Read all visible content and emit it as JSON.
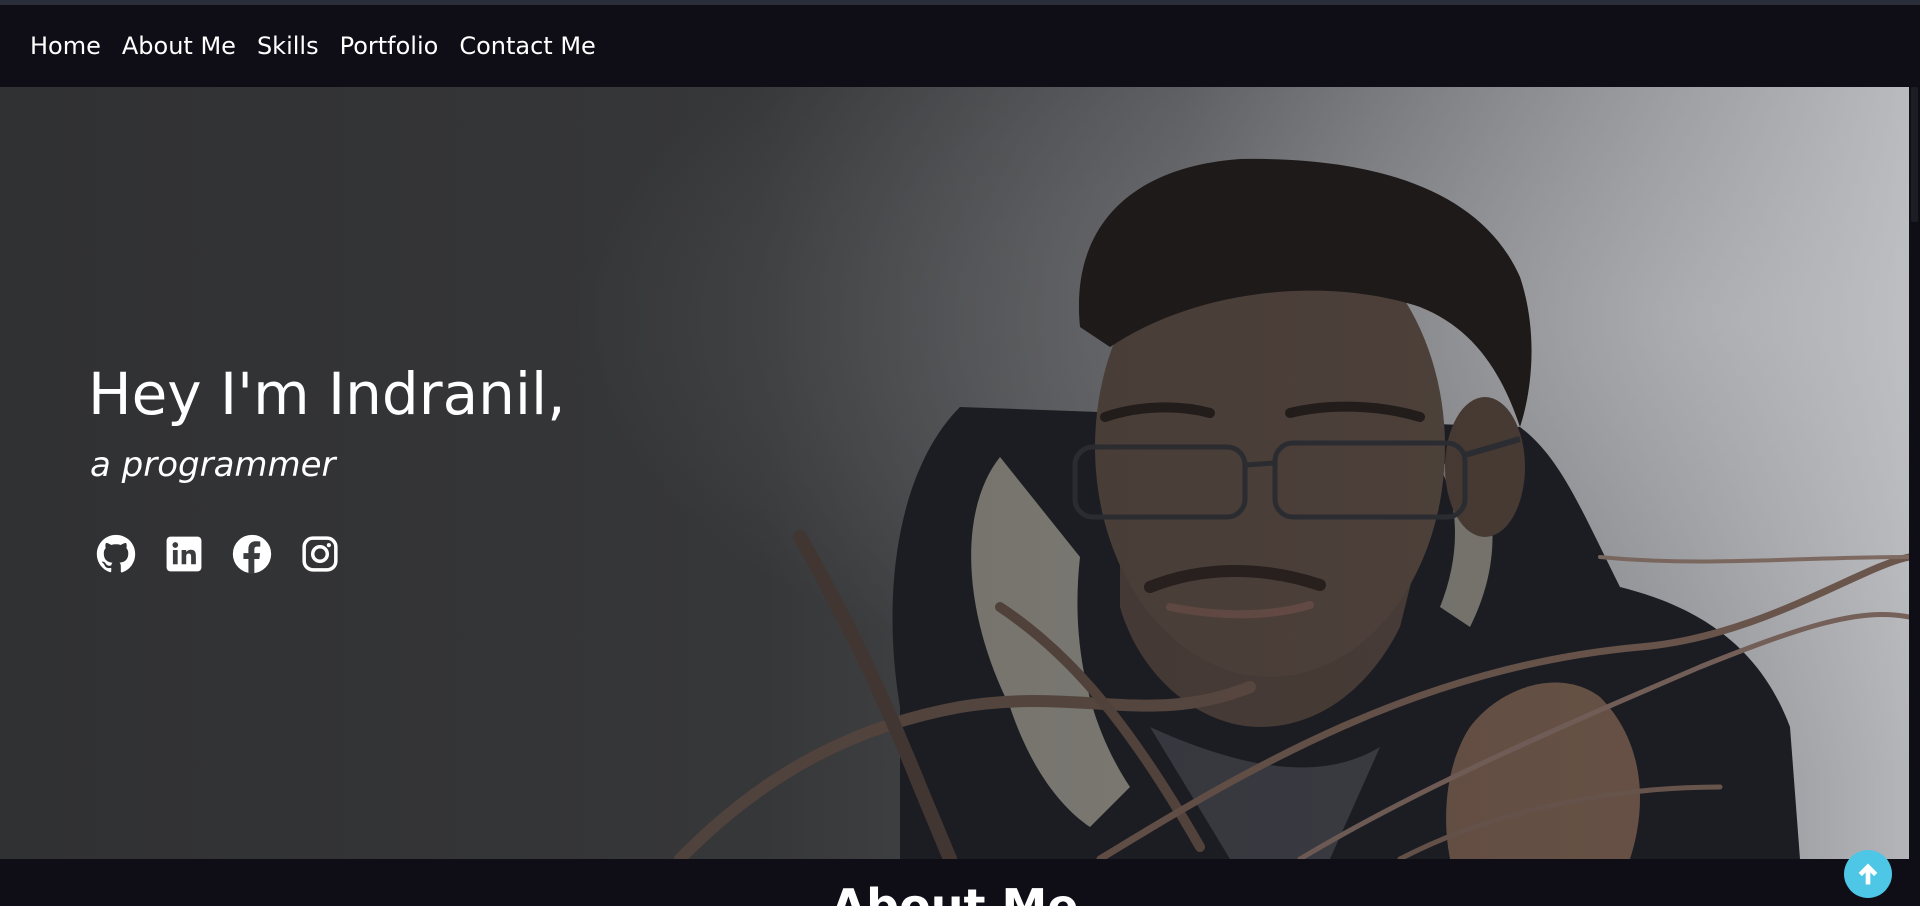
{
  "nav": {
    "items": [
      {
        "label": "Home"
      },
      {
        "label": "About Me"
      },
      {
        "label": "Skills"
      },
      {
        "label": "Portfolio"
      },
      {
        "label": "Contact Me"
      }
    ]
  },
  "hero": {
    "title": "Hey I'm Indranil,",
    "subtitle": "a programmer",
    "social": [
      {
        "icon": "github-icon"
      },
      {
        "icon": "linkedin-icon"
      },
      {
        "icon": "facebook-icon"
      },
      {
        "icon": "instagram-icon"
      }
    ]
  },
  "about": {
    "title": "About Me"
  },
  "colors": {
    "background": "#0f0e17",
    "accent": "#4ec6e6",
    "text": "#ffffff"
  }
}
